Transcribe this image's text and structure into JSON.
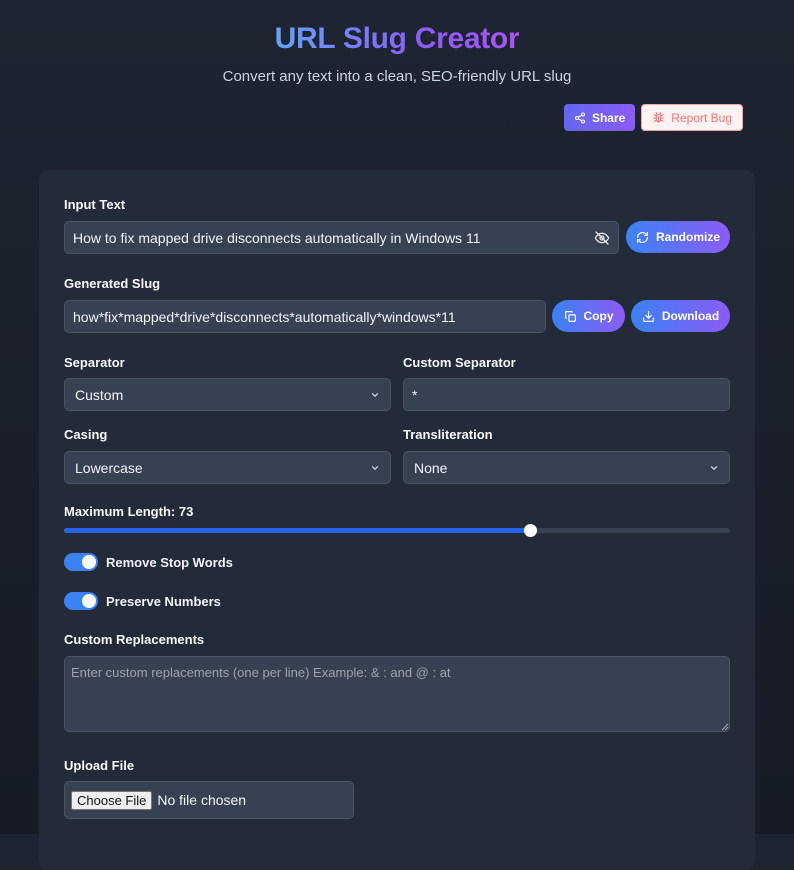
{
  "header": {
    "title": "URL Slug Creator",
    "subtitle": "Convert any text into a clean, SEO-friendly URL slug",
    "share_label": "Share",
    "report_label": "Report Bug"
  },
  "form": {
    "input_label": "Input Text",
    "input_value": "How to fix mapped drive disconnects automatically in Windows 11",
    "randomize_label": "Randomize",
    "slug_label": "Generated Slug",
    "slug_value": "how*fix*mapped*drive*disconnects*automatically*windows*11",
    "copy_label": "Copy",
    "download_label": "Download",
    "separator_label": "Separator",
    "separator_value": "Custom",
    "custom_separator_label": "Custom Separator",
    "custom_separator_value": "*",
    "casing_label": "Casing",
    "casing_value": "Lowercase",
    "transliteration_label": "Transliteration",
    "transliteration_value": "None",
    "max_length_label": "Maximum Length: 73",
    "max_length_fraction": 0.7,
    "remove_stop_words_label": "Remove Stop Words",
    "remove_stop_words": true,
    "preserve_numbers_label": "Preserve Numbers",
    "preserve_numbers": true,
    "custom_replacements_label": "Custom Replacements",
    "custom_replacements_placeholder": "Enter custom replacements (one per line) Example: & : and @ : at",
    "upload_label": "Upload File",
    "choose_file_label": "Choose File",
    "no_file_text": "No file chosen"
  },
  "colors": {
    "accent_start": "#3b82f6",
    "accent_end": "#8b5cf6",
    "card_bg": "#232a38",
    "field_bg": "#374151"
  }
}
